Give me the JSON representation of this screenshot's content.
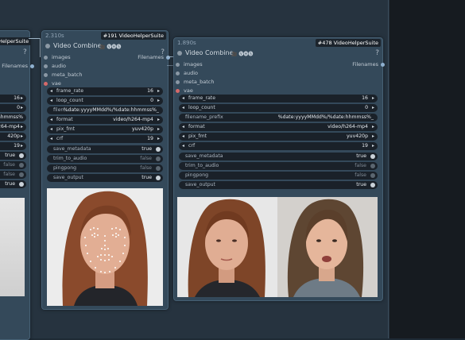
{
  "left_node": {
    "title": "HelperSuite",
    "output_label": "Filenames",
    "widgets": [
      {
        "value": "16"
      },
      {
        "value": "0"
      },
      {
        "value": "%date:yyyyMMdd%/%date:hhmmss%_"
      },
      {
        "value": "h264-mp4"
      },
      {
        "value": "420p"
      },
      {
        "value": "19"
      },
      {
        "value": "true"
      },
      {
        "value": "false"
      },
      {
        "value": "false"
      },
      {
        "value": "true"
      }
    ]
  },
  "node_a": {
    "time": "2.310s",
    "id": "#191 VideoHelperSuite",
    "title": "Video Combine",
    "title_icons": "🎥 🅥🅗🅢",
    "output_label": "Filenames",
    "inputs": [
      "images",
      "audio",
      "meta_batch",
      "vae"
    ],
    "widgets": [
      {
        "label": "frame_rate",
        "value": "16"
      },
      {
        "label": "loop_count",
        "value": "0"
      },
      {
        "label": "filen...",
        "value": "%date:yyyyMMdd%/%date:hhmmss%_"
      },
      {
        "label": "format",
        "value": "video/h264-mp4"
      },
      {
        "label": "pix_fmt",
        "value": "yuv420p"
      },
      {
        "label": "crf",
        "value": "19"
      }
    ],
    "toggles": [
      {
        "label": "save_metadata",
        "value": "true"
      },
      {
        "label": "trim_to_audio",
        "value": "false"
      },
      {
        "label": "pingpong",
        "value": "false"
      },
      {
        "label": "save_output",
        "value": "true"
      }
    ]
  },
  "node_b": {
    "time": "1.890s",
    "id": "#478 VideoHelperSuite",
    "title": "Video Combine",
    "title_icons": "🎥 🅥🅗🅢",
    "output_label": "Filenames",
    "inputs": [
      "images",
      "audio",
      "meta_batch",
      "vae"
    ],
    "widgets": [
      {
        "label": "frame_rate",
        "value": "16"
      },
      {
        "label": "loop_count",
        "value": "0"
      },
      {
        "label": "filename_prefix",
        "value": "%date:yyyyMMdd%/%date:hhmmss%_"
      },
      {
        "label": "format",
        "value": "video/h264-mp4"
      },
      {
        "label": "pix_fmt",
        "value": "yuv420p"
      },
      {
        "label": "crf",
        "value": "19"
      }
    ],
    "toggles": [
      {
        "label": "save_metadata",
        "value": "true"
      },
      {
        "label": "trim_to_audio",
        "value": "false"
      },
      {
        "label": "pingpong",
        "value": "false"
      },
      {
        "label": "save_output",
        "value": "true"
      }
    ]
  }
}
